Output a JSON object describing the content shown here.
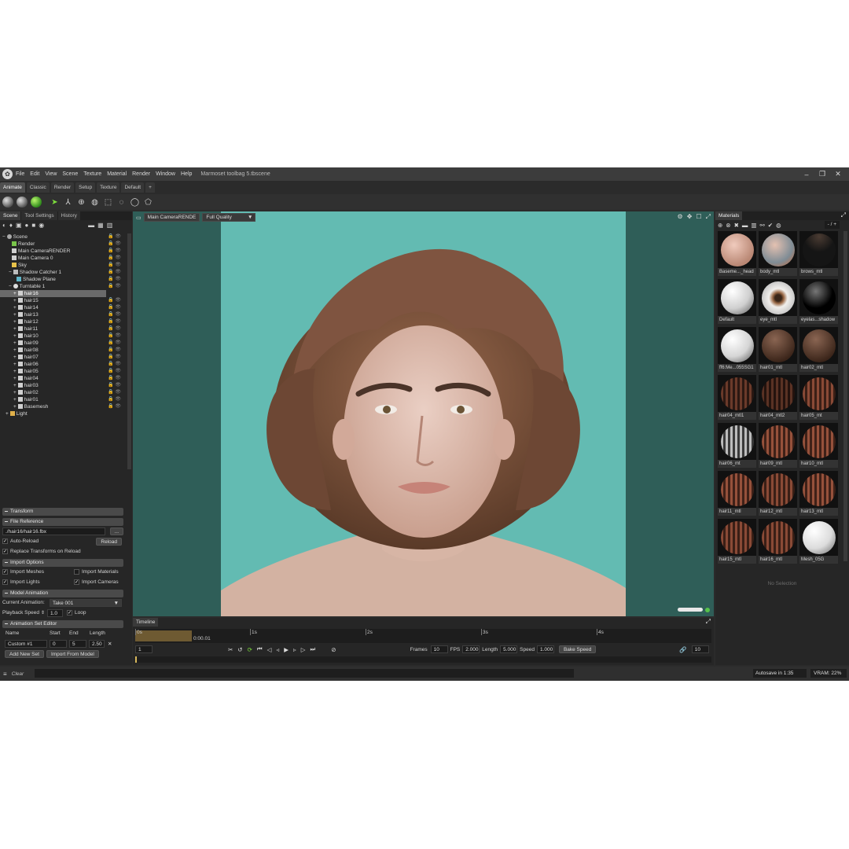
{
  "window": {
    "title": "Marmoset toolbag 5.tbscene",
    "menu": [
      "File",
      "Edit",
      "View",
      "Scene",
      "Texture",
      "Material",
      "Render",
      "Window",
      "Help"
    ]
  },
  "layout_tabs": [
    "Animate",
    "Classic",
    "Render",
    "Setup",
    "Texture",
    "Default",
    "+"
  ],
  "left_panel": {
    "tabs": [
      "Scene",
      "Tool Settings",
      "History"
    ],
    "tree": [
      "Scene",
      "Render",
      "Main CameraRENDER",
      "Main Camera 0",
      "Sky",
      "Shadow Catcher 1",
      "Shadow Plane",
      "Turntable 1",
      "hair16",
      "hair15",
      "hair14",
      "hair13",
      "hair12",
      "hair11",
      "hair10",
      "hair09",
      "hair08",
      "hair07",
      "hair06",
      "hair05",
      "hair04",
      "hair03",
      "hair02",
      "hair01",
      "Basemesh",
      "Light"
    ],
    "transform": "Transform",
    "file_reference": "File Reference",
    "file_path": "./hair16/hair16.fbx",
    "browse": "...",
    "auto_reload": "Auto-Reload",
    "reload": "Reload",
    "replace_transforms": "Replace Transforms on Reload",
    "import_options": "Import Options",
    "import_meshes": "Import Meshes",
    "import_materials": "Import Materials",
    "import_lights": "Import Lights",
    "import_cameras": "Import Cameras",
    "model_animation": "Model Animation",
    "current_animation_label": "Current Animation:",
    "current_animation": "Take 001",
    "playback_speed_label": "Playback Speed",
    "playback_speed": "1.0",
    "loop": "Loop",
    "anim_set_editor": "Animation Set Editor",
    "cols": [
      "Name",
      "Start",
      "End",
      "Length"
    ],
    "row": [
      "Custom #1",
      "0",
      "5",
      "2.50"
    ],
    "remove": "✕",
    "add_new_set": "Add New Set",
    "import_from_model": "Import From Model"
  },
  "viewport": {
    "camera": "Main CameraRENDE",
    "quality": "Full Quality"
  },
  "timeline": {
    "tab": "Timeline",
    "start_label": "0s",
    "start_time": "0:00.01",
    "marks": [
      "1s",
      "2s",
      "3s",
      "4s"
    ],
    "frame": "1",
    "frames_label": "Frames",
    "frames": "10",
    "fps_label": "FPS",
    "fps": "2.000",
    "length_label": "Length",
    "length": "5.000",
    "speed_label": "Speed",
    "speed": "1.000",
    "bake_speed": "Bake Speed",
    "keys": "10"
  },
  "materials": {
    "tab": "Materials",
    "zoom": "- / +",
    "items": [
      "Baseme..._head",
      "body_mtl",
      "brows_mtl",
      "Default",
      "eye_mtl",
      "eyelas...shadow",
      "ff6:Me...055SG1",
      "hair01_mtl",
      "hair02_mtl",
      "hair04_mtl1",
      "hair04_mtl2",
      "hair05_mt",
      "hair06_mt",
      "hair09_mtl",
      "hair10_mtl",
      "hair11_mtl",
      "hair12_mtl",
      "hair13_mtl",
      "hair15_mtl",
      "hair16_mtl",
      "Mesh_05G"
    ],
    "no_selection": "No Selection"
  },
  "status": {
    "clear": "Clear",
    "autosave": "Autosave in 1:35",
    "vram": "VRAM: 22%"
  }
}
